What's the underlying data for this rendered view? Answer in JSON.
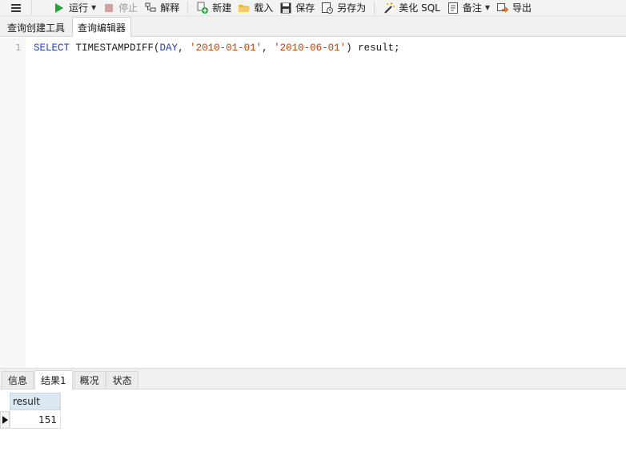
{
  "toolbar": {
    "menu_icon": "hamburger-icon",
    "run": {
      "label": "运行",
      "icon": "play-icon"
    },
    "stop": {
      "label": "停止",
      "icon": "stop-icon"
    },
    "explain": {
      "label": "解释",
      "icon": "explain-icon"
    },
    "new": {
      "label": "新建",
      "icon": "new-query-icon"
    },
    "load": {
      "label": "载入",
      "icon": "folder-open-icon"
    },
    "save": {
      "label": "保存",
      "icon": "save-icon"
    },
    "save_as": {
      "label": "另存为",
      "icon": "save-as-icon"
    },
    "beautify": {
      "label": "美化 SQL",
      "icon": "magic-wand-icon"
    },
    "notes": {
      "label": "备注",
      "icon": "notes-icon"
    },
    "export": {
      "label": "导出",
      "icon": "export-icon"
    }
  },
  "editor_tabs": [
    {
      "label": "查询创建工具",
      "active": false
    },
    {
      "label": "查询编辑器",
      "active": true
    }
  ],
  "editor": {
    "line_number": "1",
    "code": {
      "kw_select": "SELECT",
      "fn": " TIMESTAMPDIFF(",
      "kw_day": "DAY",
      "comma1": ", ",
      "str1": "'2010-01-01'",
      "comma2": ", ",
      "str2": "'2010-06-01'",
      "tail": ") result;"
    }
  },
  "result_tabs": [
    {
      "label": "信息",
      "active": false
    },
    {
      "label": "结果1",
      "active": true
    },
    {
      "label": "概况",
      "active": false
    },
    {
      "label": "状态",
      "active": false
    }
  ],
  "result_grid": {
    "columns": [
      "result"
    ],
    "rows": [
      [
        "151"
      ]
    ]
  },
  "colors": {
    "keyword": "#2a3fb8",
    "string": "#c2410c",
    "run_green": "#22a33a",
    "header_blue": "#dbe7f3"
  }
}
